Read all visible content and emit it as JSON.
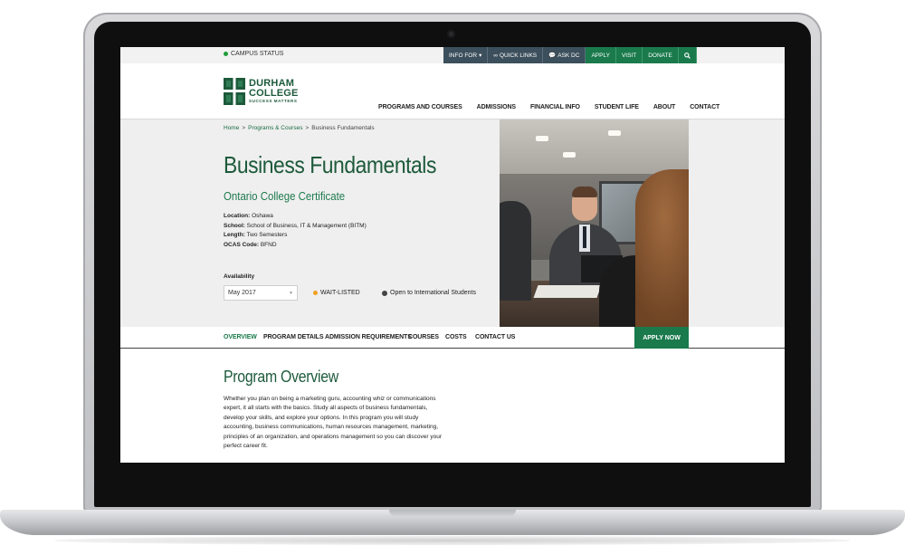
{
  "utility": {
    "campus_status": "CAMPUS STATUS",
    "info_for": "INFO FOR",
    "quick_links": "QUICK LINKS",
    "ask_dc": "ASK DC",
    "apply": "APPLY",
    "visit": "VISIT",
    "donate": "DONATE"
  },
  "logo": {
    "line1": "DURHAM",
    "line2": "COLLEGE",
    "tagline": "SUCCESS MATTERS"
  },
  "nav": [
    {
      "label": "PROGRAMS AND COURSES"
    },
    {
      "label": "ADMISSIONS"
    },
    {
      "label": "FINANCIAL INFO"
    },
    {
      "label": "STUDENT LIFE"
    },
    {
      "label": "ABOUT"
    },
    {
      "label": "CONTACT"
    }
  ],
  "breadcrumb": {
    "home": "Home",
    "sep1": ">",
    "programs": "Programs & Courses",
    "sep2": ">",
    "current": "Business Fundamentals"
  },
  "program": {
    "title": "Business Fundamentals",
    "credential": "Ontario College Certificate",
    "location_label": "Location:",
    "location_value": "Oshawa",
    "school_label": "School:",
    "school_value": "School of Business, IT & Management (BITM)",
    "length_label": "Length:",
    "length_value": "Two Semesters",
    "ocas_label": "OCAS Code:",
    "ocas_value": "BFND",
    "availability_label": "Availability",
    "availability_selected": "May 2017",
    "status": "WAIT-LISTED",
    "international": "Open to International Students"
  },
  "tabs": [
    {
      "label": "OVERVIEW"
    },
    {
      "label": "PROGRAM DETAILS"
    },
    {
      "label": "ADMISSION REQUIREMENTS"
    },
    {
      "label": "COURSES"
    },
    {
      "label": "COSTS"
    },
    {
      "label": "CONTACT US"
    }
  ],
  "apply_now": "APPLY NOW",
  "overview": {
    "title": "Program Overview",
    "body": "Whether you plan on being a marketing guru, accounting whiz or communications expert, it all starts with the basics. Study all aspects of business fundamentals, develop your skills, and explore your options. In this program you will study accounting, business communications, human resources management, marketing, principles of an organization, and operations management so you can discover your perfect career fit."
  },
  "colors": {
    "brand_green": "#1d5a3b",
    "accent_green": "#1a7a4c",
    "util_dark": "#3c4f5c",
    "status_orange": "#f0a020"
  },
  "icons": {
    "quick_links": "link-icon",
    "ask_dc": "chat-icon",
    "search": "search-icon",
    "international": "globe-icon"
  }
}
